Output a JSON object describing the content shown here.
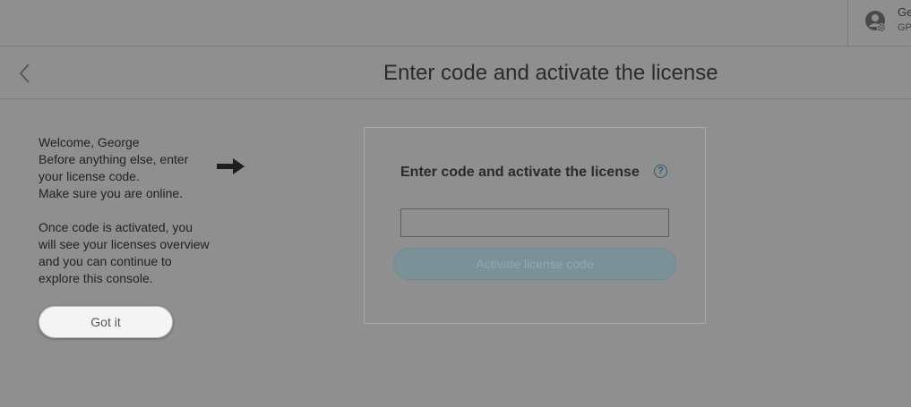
{
  "header": {
    "user_name": "George",
    "user_sub": "GPS",
    "user_icon": "user-settings-icon"
  },
  "title_bar": {
    "back_icon": "chevron-left-icon",
    "title": "Enter code and activate the license"
  },
  "tip": {
    "lines_1": [
      "Welcome, George",
      "Before anything else, enter",
      "your license code.",
      "Make sure you are online."
    ],
    "lines_2": [
      "Once code is activated, you",
      "will see your licenses overview",
      "and you can continue to",
      "explore this console."
    ],
    "arrow_icon": "arrow-right-icon",
    "button_label": "Got it"
  },
  "activation_card": {
    "title": "Enter code and activate the license",
    "help_symbol": "?",
    "code_value": "",
    "activate_label": "Activate license code",
    "activate_disabled": true
  },
  "colors": {
    "overlay": "#8f8f8f",
    "accent": "#2d5b72",
    "button_disabled": "#7b9198"
  }
}
